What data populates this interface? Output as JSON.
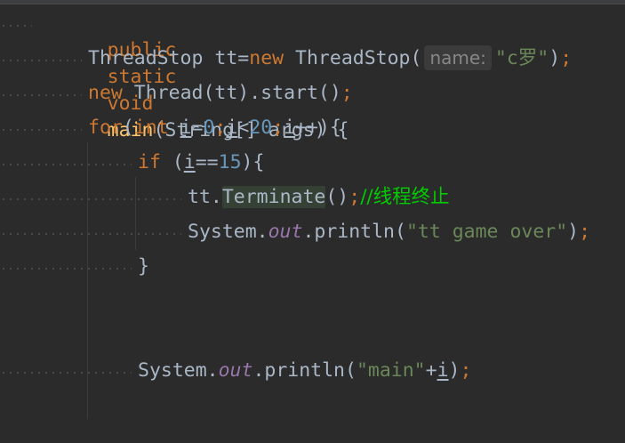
{
  "editor": {
    "lines": [
      {
        "kw1": "public",
        "kw2": "static",
        "kw3": "void",
        "method": "main",
        "params": "(String[] args) {"
      },
      {
        "type": "ThreadStop",
        "var": "tt",
        "eq": "=",
        "kw": "new",
        "ctor": "ThreadStop(",
        "hint": "name:",
        "str": "\"c罗\"",
        "close": ")",
        "semi": ";"
      },
      {
        "kw": "new",
        "rest": "Thread(tt).start()",
        "semi": ";"
      },
      {
        "kw_for": "for",
        "p1": "(",
        "kw_int": "int",
        "sp": " ",
        "v1": "i",
        "eq": "=",
        "n0": "0",
        "s1": ";",
        "v2": "i",
        "lt": "<",
        "n20": "20",
        "s2": ";",
        "v3": "i",
        "inc": "++){"
      },
      {
        "kw_if": "if",
        "p": " (",
        "v": "i",
        "eqeq": "==",
        "n15": "15",
        "close": "){"
      },
      {
        "obj": "tt.",
        "method": "Terminate",
        "call": "()",
        "semi": ";",
        "comment": "//线程终止"
      },
      {
        "sys": "System.",
        "field": "out",
        "print": ".println(",
        "str": "\"tt game over\"",
        "close": ")",
        "semi": ";"
      },
      {
        "brace": "}"
      },
      {
        "sys": "System.",
        "field": "out",
        "print": ".println(",
        "str": "\"main\"",
        "plus": "+",
        "v": "i",
        "close": ")",
        "semi": ";"
      }
    ]
  }
}
